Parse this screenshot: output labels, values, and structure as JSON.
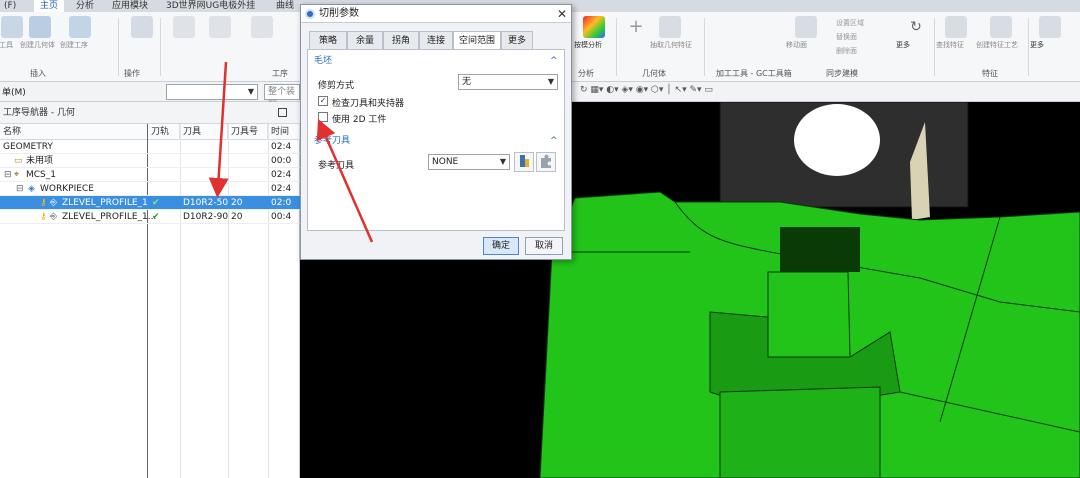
{
  "menubar": {
    "tabs": [
      "(F)",
      "主页",
      "分析",
      "应用模块",
      "3D世界网UG电极外挂",
      "曲线"
    ],
    "active_tab": "主页"
  },
  "ribbon": {
    "left_buttons": [
      "加工具",
      "创建几何体",
      "创建工序"
    ],
    "group_labels": {
      "insert": "插入",
      "operation": "操作",
      "process": "工序",
      "analysis": "分析",
      "geometry": "几何体",
      "machining_tools": "加工工具 - GC工具箱",
      "sync_modeling": "同步建模",
      "feature": "特征"
    },
    "right_buttons": {
      "deviation": "按模分析",
      "extract_geometry": "抽取几何特征",
      "more1": "更多",
      "more2": "更多",
      "more3": "更多",
      "move_face": "移动面",
      "find_feature": "查找特征",
      "create_feature_process": "创建特征工艺"
    },
    "misc_labels": [
      "设置区域",
      "替换面",
      "删除面"
    ],
    "filter_placeholder": "整个装配",
    "unit_label": "单(M)"
  },
  "navigator": {
    "title": "工序导航器 - 几何",
    "columns": [
      "名称",
      "刀轨",
      "刀具",
      "刀具号",
      "时间"
    ],
    "rows": [
      {
        "name": "GEOMETRY",
        "path": "",
        "tool": "",
        "tool_no": "",
        "time": "02:4"
      },
      {
        "name": "未用项",
        "path": "",
        "tool": "",
        "tool_no": "",
        "time": "00:0"
      },
      {
        "name": "MCS_1",
        "path": "",
        "tool": "",
        "tool_no": "",
        "time": "02:4"
      },
      {
        "name": "WORKPIECE",
        "path": "",
        "tool": "",
        "tool_no": "",
        "time": "02:4"
      },
      {
        "name": "ZLEVEL_PROFILE_1",
        "path": "✔",
        "tool": "D10R2-50",
        "tool_no": "20",
        "time": "02:0"
      },
      {
        "name": "ZLEVEL_PROFILE_1...",
        "path": "✔",
        "tool": "D10R2-90",
        "tool_no": "20",
        "time": "00:4"
      }
    ]
  },
  "dialog": {
    "title": "切削参数",
    "tabs": [
      "策略",
      "余量",
      "拐角",
      "连接",
      "空间范围",
      "更多"
    ],
    "active_tab": "空间范围",
    "blank_section": "毛坯",
    "trim_method_label": "修剪方式",
    "trim_method_value": "无",
    "check_tool_holder_label": "检查刀具和夹持器",
    "check_tool_holder_checked": true,
    "use_2d_workpiece_label": "使用 2D 工件",
    "use_2d_workpiece_checked": false,
    "ref_tool_section": "参考刀具",
    "ref_tool_label": "参考刀具",
    "ref_tool_value": "NONE",
    "ok_label": "确定",
    "cancel_label": "取消"
  },
  "colors": {
    "selection": "#3b8fe0",
    "model_green": "#22c41a",
    "check_green": "#1f9a2e",
    "annotation_red": "#e03030"
  }
}
